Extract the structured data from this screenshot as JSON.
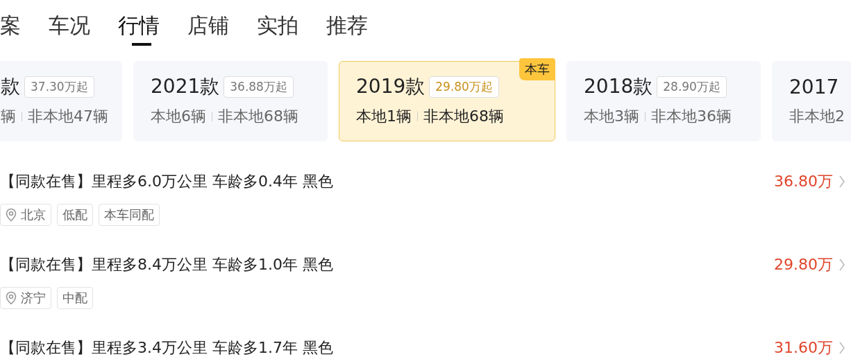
{
  "tabs": [
    {
      "label": "案",
      "selected": false
    },
    {
      "label": "车况",
      "selected": false
    },
    {
      "label": "行情",
      "selected": true
    },
    {
      "label": "店铺",
      "selected": false
    },
    {
      "label": "实拍",
      "selected": false
    },
    {
      "label": "推荐",
      "selected": false
    }
  ],
  "model_years": [
    {
      "title": "款",
      "price": "37.30万起",
      "local": "辆",
      "nonlocal": "非本地47辆",
      "selected": false
    },
    {
      "title": "2021款",
      "price": "36.88万起",
      "local": "本地6辆",
      "nonlocal": "非本地68辆",
      "selected": false
    },
    {
      "title": "2019款",
      "price": "29.80万起",
      "local": "本地1辆",
      "nonlocal": "非本地68辆",
      "selected": true,
      "badge": "本车"
    },
    {
      "title": "2018款",
      "price": "28.90万起",
      "local": "本地3辆",
      "nonlocal": "非本地36辆",
      "selected": false
    },
    {
      "title": "2017",
      "nonlocal": "非本地2",
      "selected": false
    }
  ],
  "listings": [
    {
      "title": "【同款在售】里程多6.0万公里 车龄多0.4年 黑色",
      "price": "36.80万",
      "location": "北京",
      "tags": [
        "低配",
        "本车同配"
      ]
    },
    {
      "title": "【同款在售】里程多8.4万公里 车龄多1.0年 黑色",
      "price": "29.80万",
      "location": "济宁",
      "tags": [
        "中配"
      ]
    },
    {
      "title": "【同款在售】里程多3.4万公里 车龄多1.7年 黑色",
      "price": "31.60万"
    }
  ]
}
